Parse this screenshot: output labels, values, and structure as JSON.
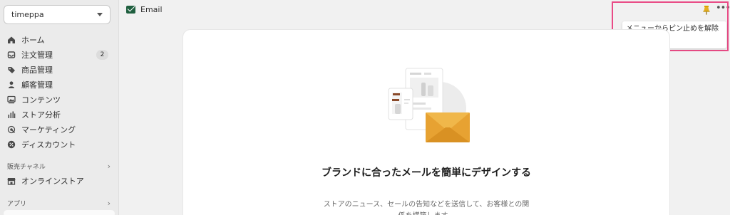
{
  "store": {
    "name": "timeppa"
  },
  "nav": {
    "items": [
      {
        "label": "ホーム",
        "icon": "home-icon"
      },
      {
        "label": "注文管理",
        "icon": "inbox-icon",
        "badge": "2"
      },
      {
        "label": "商品管理",
        "icon": "tag-icon"
      },
      {
        "label": "顧客管理",
        "icon": "person-icon"
      },
      {
        "label": "コンテンツ",
        "icon": "image-icon"
      },
      {
        "label": "ストア分析",
        "icon": "bar-chart-icon"
      },
      {
        "label": "マーケティング",
        "icon": "target-icon"
      },
      {
        "label": "ディスカウント",
        "icon": "discount-icon"
      }
    ]
  },
  "sales_channels": {
    "heading": "販売チャネル",
    "items": [
      {
        "label": "オンラインストア",
        "icon": "store-icon"
      }
    ]
  },
  "apps": {
    "heading": "アプリ"
  },
  "topbar": {
    "title": "Email",
    "more": "•••"
  },
  "tooltip": {
    "text": "メニューからピン止めを解除する"
  },
  "main": {
    "title": "ブランドに合ったメールを簡単にデザインする",
    "description": "ストアのニュース、セールの告知などを送信して、お客様との関係を構築します。"
  },
  "colors": {
    "highlight": "#e94b86",
    "pin": "#d9a400",
    "envelope": "#e7a232",
    "brand": "#1f5f3f"
  }
}
